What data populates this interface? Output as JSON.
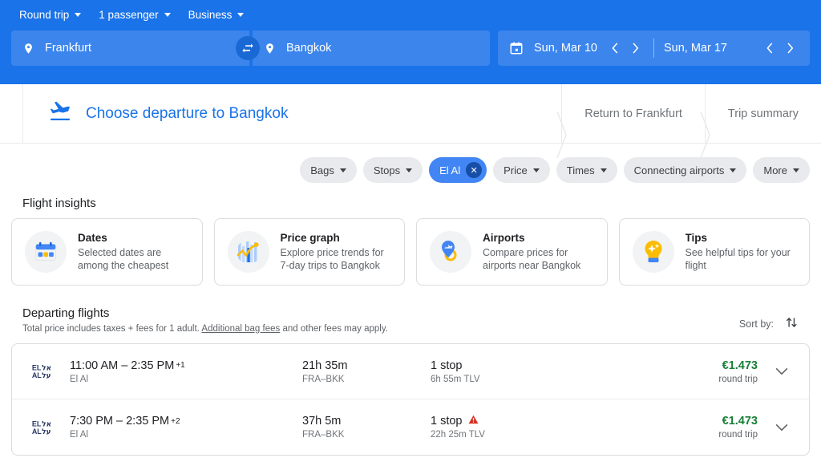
{
  "search_header": {
    "options": [
      {
        "label": "Round trip",
        "name": "trip-type-selector"
      },
      {
        "label": "1 passenger",
        "name": "passengers-selector"
      },
      {
        "label": "Business",
        "name": "cabin-class-selector"
      }
    ],
    "origin": {
      "value": "Frankfurt",
      "placeholder": "Where from?"
    },
    "destination": {
      "value": "Bangkok",
      "placeholder": "Where to?"
    },
    "swap_label": "Swap origin and destination",
    "departure_date": "Sun, Mar 10",
    "return_date": "Sun, Mar 17",
    "accent_color": "#1a73e8",
    "field_color": "#3c85ed"
  },
  "steps": {
    "active": "Choose departure to Bangkok",
    "inactive": [
      "Return to Frankfurt",
      "Trip summary"
    ]
  },
  "filters": [
    {
      "label": "Bags",
      "selected": false
    },
    {
      "label": "Stops",
      "selected": false
    },
    {
      "label": "El Al",
      "selected": true,
      "close": "✕"
    },
    {
      "label": "Price",
      "selected": false
    },
    {
      "label": "Times",
      "selected": false
    },
    {
      "label": "Connecting airports",
      "selected": false
    },
    {
      "label": "More",
      "selected": false
    }
  ],
  "insights": {
    "title": "Flight insights",
    "cards": [
      {
        "icon": "calendar-icon",
        "title": "Dates",
        "subtitle": "Selected dates are among the cheapest"
      },
      {
        "icon": "price-graph-icon",
        "title": "Price graph",
        "subtitle": "Explore price trends for 7-day trips to Bangkok"
      },
      {
        "icon": "airport-pin-icon",
        "title": "Airports",
        "subtitle": "Compare prices for airports near Bangkok"
      },
      {
        "icon": "lightbulb-icon",
        "title": "Tips",
        "subtitle": "See helpful tips for your flight"
      }
    ]
  },
  "departing": {
    "title": "Departing flights",
    "note_before": "Total price includes taxes + fees for 1 adult. ",
    "note_link": "Additional bag fees",
    "note_after": " and other fees may apply.",
    "sort_label": "Sort by:",
    "price_color": "#188038",
    "flights": [
      {
        "airline_logo_latin": "EL\nAL",
        "airline_logo_hebrew": "אל\nעל",
        "times": "11:00 AM – 2:35 PM",
        "day_offset": "+1",
        "airline": "El Al",
        "duration": "21h 35m",
        "route": "FRA–BKK",
        "stops": "1 stop",
        "warning": false,
        "layover": "6h 55m TLV",
        "price": "€1.473",
        "price_type": "round trip"
      },
      {
        "airline_logo_latin": "EL\nAL",
        "airline_logo_hebrew": "אל\nעל",
        "times": "7:30 PM – 2:35 PM",
        "day_offset": "+2",
        "airline": "El Al",
        "duration": "37h 5m",
        "route": "FRA–BKK",
        "stops": "1 stop",
        "warning": true,
        "layover": "22h 25m TLV",
        "price": "€1.473",
        "price_type": "round trip"
      }
    ]
  }
}
